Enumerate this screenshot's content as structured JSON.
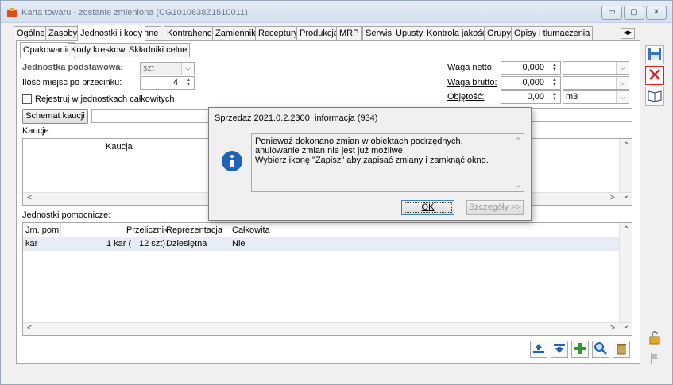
{
  "window": {
    "title": "Karta towaru - zostanie zmieniona (CG1010638Z1510011)",
    "minimize": "▭",
    "maximize": "▢",
    "close": "✕"
  },
  "tabs": [
    "Ogólne",
    "Zasoby",
    "Jednostki i kody",
    "Inne",
    "Kontrahenci",
    "Zamienniki",
    "Receptury",
    "Produkcja",
    "MRP",
    "Serwis",
    "Upusty",
    "Kontrola jakości",
    "Grupy",
    "Opisy i tłumaczenia"
  ],
  "active_tab": "Jednostki i kody",
  "subtabs": [
    "Opakowanie",
    "Kody kreskowe",
    "Składniki celne"
  ],
  "form": {
    "base_unit_label": "Jednostka podstawowa:",
    "base_unit_value": "szt",
    "decimals_label": "Ilość miejsc po przecinku:",
    "decimals_value": "4",
    "register_whole_label": "Rejestruj w jednostkach całkowitych",
    "deposit_scheme_button": "Schemat kaucji",
    "deposits_label": "Kaucje:",
    "deposit_col": "Kaucja",
    "net_weight_label": "Waga netto:",
    "net_weight_value": "0,000",
    "gross_weight_label": "Waga brutto:",
    "gross_weight_value": "0,000",
    "volume_label": "Objętość:",
    "volume_value": "0,00",
    "volume_unit": "m3"
  },
  "aux_units": {
    "label": "Jednostki pomocnicze:",
    "columns": [
      "Jm. pom.",
      "Przelicznik",
      "Reprezentacja",
      "Całkowita"
    ],
    "rows": [
      {
        "unit": "kar",
        "factor": "1 kar (",
        "factor_base": "12 szt)",
        "repr": "Dziesiętna",
        "whole": "Nie"
      }
    ]
  },
  "dialog": {
    "title": "Sprzedaż 2021.0.2.2300: informacja (934)",
    "lines": [
      "Ponieważ dokonano zmian w obiektach podrzędnych,",
      "anulowanie zmian nie jest już możliwe.",
      "Wybierz ikonę \"Zapisz\" aby zapisać zmiany i zamknąć okno."
    ],
    "ok": "OK",
    "details": "Szczegóły >>"
  },
  "colors": {
    "accent": "#1e63b5",
    "close_red": "#d9261c",
    "add_green": "#2e9a2e"
  }
}
